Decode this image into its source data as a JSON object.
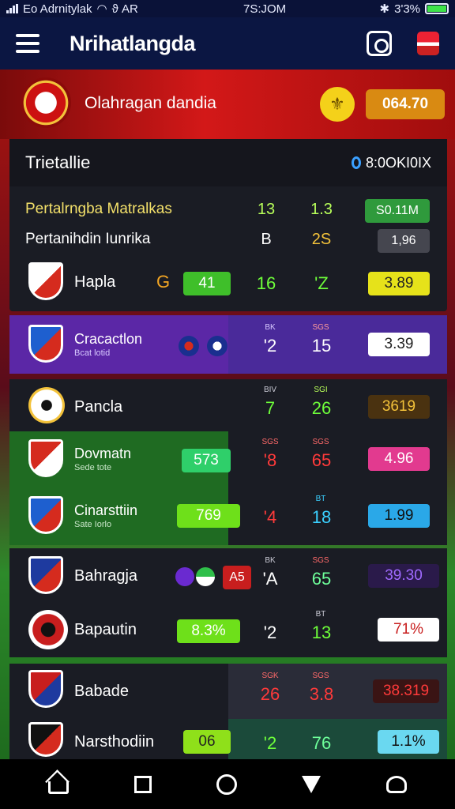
{
  "status_bar": {
    "carrier": "Eo Adrnitylak",
    "wifi_icon": "wifi-icon",
    "extra": "ϑ AR",
    "time": "7S:JOM",
    "battery": "3'3%"
  },
  "app_bar": {
    "title": "Nrihatlangda",
    "menu_icon": "hamburger-icon",
    "camera_icon": "camera-icon",
    "flag_icon": "flag-icon"
  },
  "hero": {
    "league": "Olahragan dandia",
    "coin_icon": "coin-icon",
    "balance": "064.70"
  },
  "table": {
    "title": "Trietallie",
    "timer": "8:0OKI0IX",
    "meta_rows": [
      {
        "name": "Pertalrngba Matralkas",
        "a": "13",
        "b": "1.3",
        "badge": "S0.11M"
      },
      {
        "name": "Pertanihdin Iunrika",
        "a": "B",
        "b": "2S",
        "badge": "1,96"
      }
    ],
    "rows": [
      {
        "name": "Hapla",
        "sub": "",
        "mark": "G",
        "pill": "41",
        "a": "16",
        "b": "'Z",
        "odds": "3.89",
        "a_hdr": "",
        "b_hdr": ""
      },
      {
        "name": "Cracactlon",
        "sub": "Bcat lotid",
        "mark": "",
        "pill": "",
        "a": "'2",
        "b": "15",
        "odds": "3.39",
        "a_hdr": "BK",
        "b_hdr": "SGS"
      },
      {
        "name": "Pancla",
        "sub": "",
        "mark": "",
        "pill": "",
        "a": "7",
        "b": "26",
        "odds": "3619",
        "a_hdr": "BIV",
        "b_hdr": "SGI"
      },
      {
        "name": "Dovmatn",
        "sub": "Sede tote",
        "mark": "",
        "pill": "573",
        "a": "'8",
        "b": "65",
        "odds": "4.96",
        "a_hdr": "SGS",
        "b_hdr": "SGS"
      },
      {
        "name": "Cinarsttiin",
        "sub": "Sate Iorlo",
        "mark": "",
        "pill": "769",
        "a": "'4",
        "b": "18",
        "odds": "1.99",
        "a_hdr": "",
        "b_hdr": "BT"
      },
      {
        "name": "Bahragja",
        "sub": "",
        "mark": "A5",
        "pill": "",
        "a": "'A",
        "b": "65",
        "odds": "39.30",
        "a_hdr": "BK",
        "b_hdr": "SGS"
      },
      {
        "name": "Bapautin",
        "sub": "",
        "mark": "",
        "pill": "8.3%",
        "a": "'2",
        "b": "13",
        "odds": "71%",
        "a_hdr": "",
        "b_hdr": "BT"
      },
      {
        "name": "Babade",
        "sub": "",
        "mark": "",
        "pill": "",
        "a": "26",
        "b": "3.8",
        "odds": "38.319",
        "a_hdr": "SGK",
        "b_hdr": "SGS"
      },
      {
        "name": "Narsthodiin",
        "sub": "",
        "mark": "",
        "pill": "06",
        "a": "'2",
        "b": "76",
        "odds": "1.1%",
        "a_hdr": "",
        "b_hdr": ""
      }
    ]
  },
  "nav": {
    "home": "home-icon",
    "recents": "square-icon",
    "circle": "circle-icon",
    "back": "triangle-icon",
    "profile": "user-icon"
  }
}
